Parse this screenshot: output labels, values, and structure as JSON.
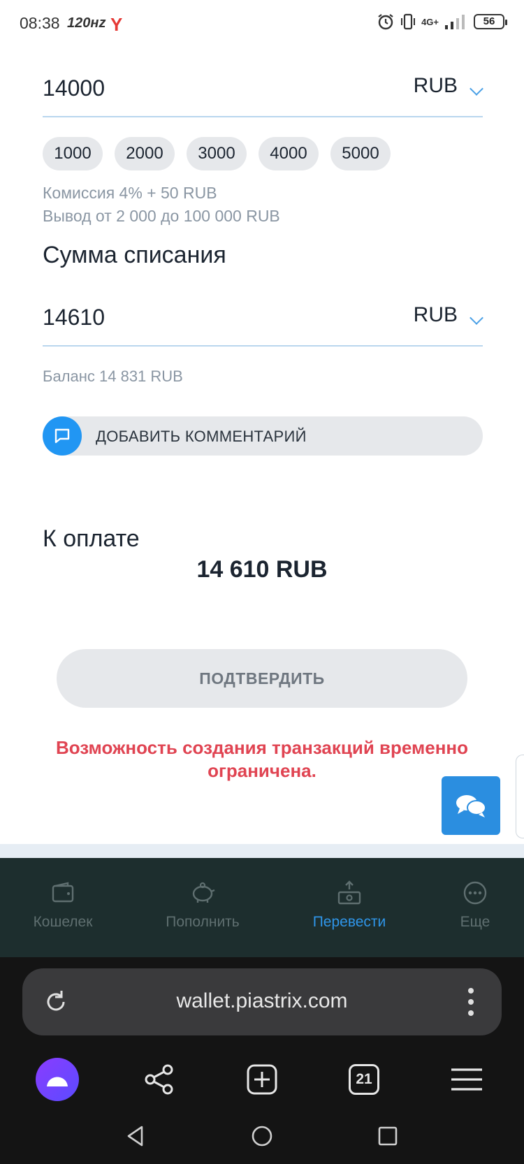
{
  "status_bar": {
    "time": "08:38",
    "refresh": "120нz",
    "yandex_mark": "Y",
    "network": "4G+",
    "battery": "56"
  },
  "amount_field": {
    "value": "14000",
    "currency": "RUB"
  },
  "presets": [
    "1000",
    "2000",
    "3000",
    "4000",
    "5000"
  ],
  "commission_text": "Комиссия 4% + 50 RUB",
  "limits_text": "Вывод от 2 000 до 100 000 RUB",
  "debit_title": "Сумма списания",
  "debit_field": {
    "value": "14610",
    "currency": "RUB"
  },
  "balance_text": "Баланс 14 831 RUB",
  "comment_button": "ДОБАВИТЬ КОММЕНТАРИЙ",
  "pay_title": "К оплате",
  "pay_amount": "14 610 RUB",
  "confirm_button": "ПОДТВЕРДИТЬ",
  "error_message": "Возможность создания транзакций временно ограничена.",
  "bottom_nav": [
    {
      "label": "Кошелек",
      "icon": "wallet-icon",
      "active": false
    },
    {
      "label": "Пополнить",
      "icon": "piggy-bank-icon",
      "active": false
    },
    {
      "label": "Перевести",
      "icon": "transfer-icon",
      "active": true
    },
    {
      "label": "Еще",
      "icon": "more-icon",
      "active": false
    }
  ],
  "browser": {
    "url": "wallet.piastrix.com",
    "tab_count": "21"
  },
  "colors": {
    "accent": "#2f95e8",
    "error": "#e04452",
    "nav_bg": "#1d2e2e"
  }
}
